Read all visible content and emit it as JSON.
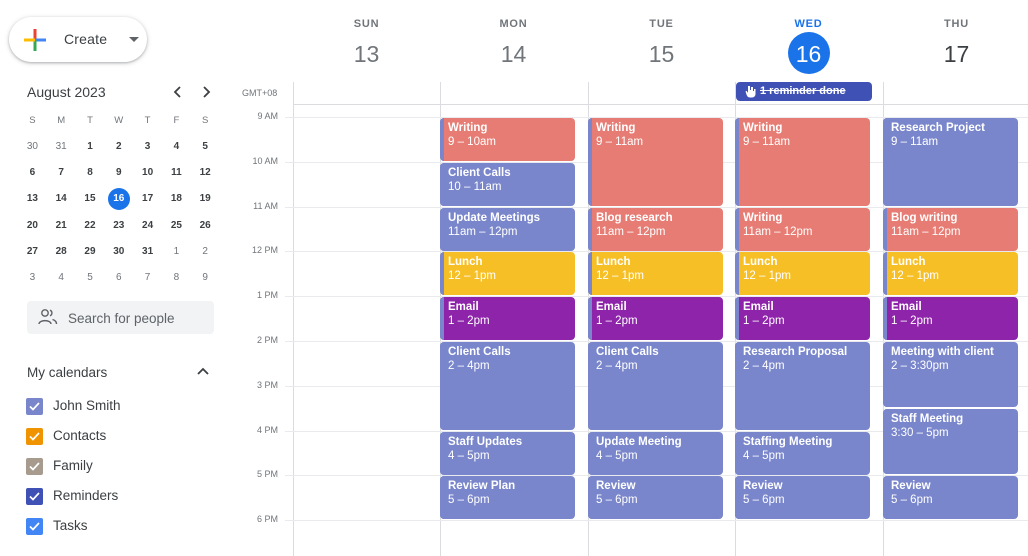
{
  "colors": {
    "accent": "#1a73e8",
    "lavender": "#7986cb",
    "flamingo": "#e67c73",
    "banana": "#f6bf26",
    "grape": "#8e24aa",
    "blueberry": "#3f51b5"
  },
  "create": {
    "label": "Create",
    "icon": "plus-icon",
    "caret": "chevron-down-icon"
  },
  "mini_calendar": {
    "title": "August 2023",
    "prev": "‹",
    "next": "›",
    "weekdays": [
      "S",
      "M",
      "T",
      "W",
      "T",
      "F",
      "S"
    ],
    "weeks": [
      [
        {
          "d": "30",
          "o": true
        },
        {
          "d": "31",
          "o": true
        },
        {
          "d": "1"
        },
        {
          "d": "2"
        },
        {
          "d": "3"
        },
        {
          "d": "4"
        },
        {
          "d": "5"
        }
      ],
      [
        {
          "d": "6"
        },
        {
          "d": "7"
        },
        {
          "d": "8"
        },
        {
          "d": "9"
        },
        {
          "d": "10"
        },
        {
          "d": "11"
        },
        {
          "d": "12"
        }
      ],
      [
        {
          "d": "13"
        },
        {
          "d": "14"
        },
        {
          "d": "15"
        },
        {
          "d": "16",
          "today": true
        },
        {
          "d": "17"
        },
        {
          "d": "18"
        },
        {
          "d": "19"
        }
      ],
      [
        {
          "d": "20"
        },
        {
          "d": "21"
        },
        {
          "d": "22"
        },
        {
          "d": "23"
        },
        {
          "d": "24"
        },
        {
          "d": "25"
        },
        {
          "d": "26"
        }
      ],
      [
        {
          "d": "27"
        },
        {
          "d": "28"
        },
        {
          "d": "29"
        },
        {
          "d": "30"
        },
        {
          "d": "31"
        },
        {
          "d": "1",
          "o": true
        },
        {
          "d": "2",
          "o": true
        }
      ],
      [
        {
          "d": "3",
          "o": true
        },
        {
          "d": "4",
          "o": true
        },
        {
          "d": "5",
          "o": true
        },
        {
          "d": "6",
          "o": true
        },
        {
          "d": "7",
          "o": true
        },
        {
          "d": "8",
          "o": true
        },
        {
          "d": "9",
          "o": true
        }
      ]
    ]
  },
  "people_search": {
    "placeholder": "Search for people"
  },
  "my_calendars": {
    "title": "My calendars",
    "items": [
      {
        "label": "John Smith",
        "color": "#7986cb",
        "checked": true
      },
      {
        "label": "Contacts",
        "color": "#f09300",
        "checked": true
      },
      {
        "label": "Family",
        "color": "#a79b8e",
        "checked": true
      },
      {
        "label": "Reminders",
        "color": "#3f51b5",
        "checked": true
      },
      {
        "label": "Tasks",
        "color": "#4285f4",
        "checked": true
      }
    ]
  },
  "timezone": "GMT+08",
  "days": [
    {
      "dow": "SUN",
      "num": "13",
      "state": "past"
    },
    {
      "dow": "MON",
      "num": "14",
      "state": "past"
    },
    {
      "dow": "TUE",
      "num": "15",
      "state": "past"
    },
    {
      "dow": "WED",
      "num": "16",
      "state": "today"
    },
    {
      "dow": "THU",
      "num": "17",
      "state": "future"
    }
  ],
  "hours": [
    "9 AM",
    "10 AM",
    "11 AM",
    "12 PM",
    "1 PM",
    "2 PM",
    "3 PM",
    "4 PM",
    "5 PM",
    "6 PM"
  ],
  "reminder_chip": {
    "label": "1 reminder done",
    "day": 3
  },
  "events": [
    {
      "day": 1,
      "title": "Writing",
      "time": "9 – 10am",
      "start": 9,
      "end": 10,
      "color": "flamingo"
    },
    {
      "day": 1,
      "title": "Client Calls",
      "time": "10 – 11am",
      "start": 10,
      "end": 11,
      "color": "lavender"
    },
    {
      "day": 1,
      "title": "Update Meetings",
      "time": "11am – 12pm",
      "start": 11,
      "end": 12,
      "color": "lavender"
    },
    {
      "day": 1,
      "title": "Lunch",
      "time": "12 – 1pm",
      "start": 12,
      "end": 13,
      "color": "banana"
    },
    {
      "day": 1,
      "title": "Email",
      "time": "1 – 2pm",
      "start": 13,
      "end": 14,
      "color": "grape"
    },
    {
      "day": 1,
      "title": "Client Calls",
      "time": "2 – 4pm",
      "start": 14,
      "end": 16,
      "color": "lavender"
    },
    {
      "day": 1,
      "title": "Staff Updates",
      "time": "4 – 5pm",
      "start": 16,
      "end": 17,
      "color": "lavender"
    },
    {
      "day": 1,
      "title": "Review Plan",
      "time": "5 – 6pm",
      "start": 17,
      "end": 18,
      "color": "lavender"
    },
    {
      "day": 2,
      "title": "Writing",
      "time": "9 – 11am",
      "start": 9,
      "end": 11,
      "color": "flamingo"
    },
    {
      "day": 2,
      "title": "Blog research",
      "time": "11am – 12pm",
      "start": 11,
      "end": 12,
      "color": "flamingo"
    },
    {
      "day": 2,
      "title": "Lunch",
      "time": "12 – 1pm",
      "start": 12,
      "end": 13,
      "color": "banana"
    },
    {
      "day": 2,
      "title": "Email",
      "time": "1 – 2pm",
      "start": 13,
      "end": 14,
      "color": "grape"
    },
    {
      "day": 2,
      "title": "Client Calls",
      "time": "2 – 4pm",
      "start": 14,
      "end": 16,
      "color": "lavender"
    },
    {
      "day": 2,
      "title": "Update Meeting",
      "time": "4 – 5pm",
      "start": 16,
      "end": 17,
      "color": "lavender"
    },
    {
      "day": 2,
      "title": "Review",
      "time": "5 – 6pm",
      "start": 17,
      "end": 18,
      "color": "lavender"
    },
    {
      "day": 3,
      "title": "Writing",
      "time": "9 – 11am",
      "start": 9,
      "end": 11,
      "color": "flamingo"
    },
    {
      "day": 3,
      "title": "Writing",
      "time": "11am – 12pm",
      "start": 11,
      "end": 12,
      "color": "flamingo"
    },
    {
      "day": 3,
      "title": "Lunch",
      "time": "12 – 1pm",
      "start": 12,
      "end": 13,
      "color": "banana"
    },
    {
      "day": 3,
      "title": "Email",
      "time": "1 – 2pm",
      "start": 13,
      "end": 14,
      "color": "grape"
    },
    {
      "day": 3,
      "title": "Research Proposal",
      "time": "2 – 4pm",
      "start": 14,
      "end": 16,
      "color": "lavender"
    },
    {
      "day": 3,
      "title": "Staffing Meeting",
      "time": "4 – 5pm",
      "start": 16,
      "end": 17,
      "color": "lavender"
    },
    {
      "day": 3,
      "title": "Review",
      "time": "5 – 6pm",
      "start": 17,
      "end": 18,
      "color": "lavender"
    },
    {
      "day": 4,
      "title": "Research Project",
      "time": "9 – 11am",
      "start": 9,
      "end": 11,
      "color": "lavender"
    },
    {
      "day": 4,
      "title": "Blog writing",
      "time": "11am – 12pm",
      "start": 11,
      "end": 12,
      "color": "flamingo"
    },
    {
      "day": 4,
      "title": "Lunch",
      "time": "12 – 1pm",
      "start": 12,
      "end": 13,
      "color": "banana"
    },
    {
      "day": 4,
      "title": "Email",
      "time": "1 – 2pm",
      "start": 13,
      "end": 14,
      "color": "grape"
    },
    {
      "day": 4,
      "title": "Meeting with client",
      "time": "2 – 3:30pm",
      "start": 14,
      "end": 15.5,
      "color": "lavender"
    },
    {
      "day": 4,
      "title": "Staff Meeting",
      "time": "3:30 – 5pm",
      "start": 15.5,
      "end": 17,
      "color": "lavender"
    },
    {
      "day": 4,
      "title": "Review",
      "time": "5 – 6pm",
      "start": 17,
      "end": 18,
      "color": "lavender"
    }
  ]
}
